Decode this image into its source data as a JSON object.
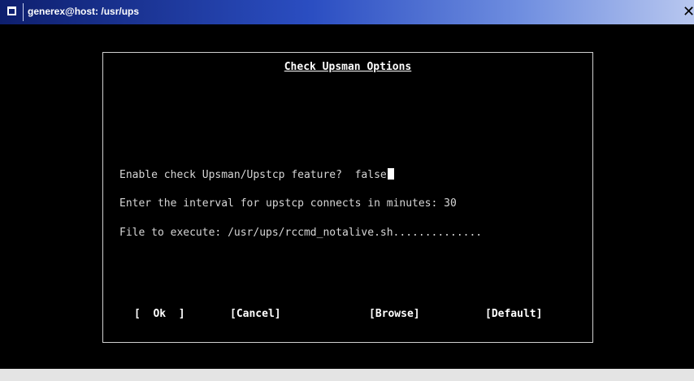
{
  "window": {
    "title": "generex@host: /usr/ups",
    "close_glyph": "✕",
    "icon_name": "window-menu-icon",
    "titlebar_colors": [
      "#0e1f6e",
      "#2b4ec2",
      "#b8c7ef"
    ]
  },
  "dialog": {
    "title": "Check Upsman Options",
    "fields": [
      {
        "label": "Enable check Upsman/Upstcp feature?",
        "value": "false"
      },
      {
        "label": "Enter the interval for upstcp connects in minutes:",
        "value": "30"
      },
      {
        "label": "File to execute:",
        "value": "/usr/ups/rccmd_notalive.sh.............."
      }
    ],
    "buttons": {
      "ok": "[  Ok  ]",
      "cancel": "[Cancel]",
      "browse": "[Browse]",
      "default": "[Default]"
    }
  }
}
